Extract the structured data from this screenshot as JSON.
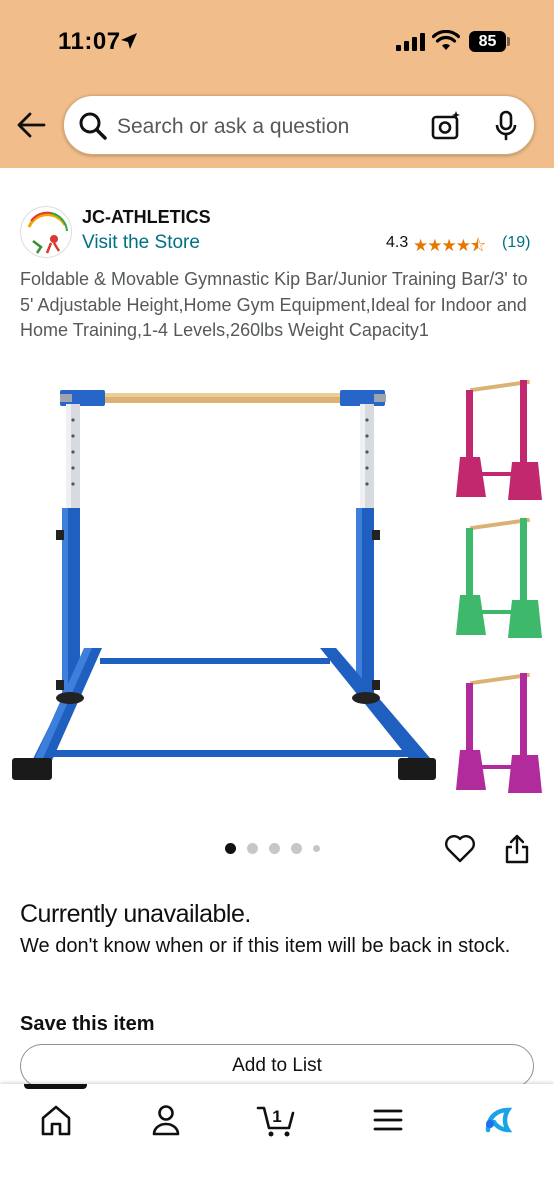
{
  "status_bar": {
    "time": "11:07",
    "battery": "85",
    "icons": [
      "location-arrow-icon",
      "signal-icon",
      "wifi-icon",
      "battery-icon"
    ]
  },
  "search": {
    "placeholder": "Search or ask a question",
    "icons": [
      "back-arrow-icon",
      "search-icon",
      "camera-icon",
      "mic-icon"
    ]
  },
  "store": {
    "brand": "JC-ATHLETICS",
    "visit": "Visit the Store",
    "logo_text": "JC-ATHLETICS"
  },
  "rating": {
    "value": "4.3",
    "stars": "★★★★⯪",
    "count": "(19)"
  },
  "product": {
    "title": "Foldable & Movable Gymnastic Kip Bar/Junior Training Bar/3' to 5' Adjustable Height,Home Gym Equipment,Ideal for Indoor and Home Training,1-4 Levels,260lbs Weight Capacity1",
    "image_count": 5,
    "active_image": 1,
    "thumbnail_colors": [
      "#c2286e",
      "#3eb86a",
      "#b22b9c"
    ]
  },
  "availability": {
    "heading": "Currently unavailable.",
    "message": "We don't know when or if this item will be back in stock."
  },
  "save": {
    "heading": "Save this item",
    "add_to_list": "Add to List"
  },
  "bottom_nav": {
    "items": [
      "home-icon",
      "account-icon",
      "cart-icon",
      "menu-icon",
      "rufus-icon"
    ],
    "cart_count": "1"
  },
  "colors": {
    "header_bg": "#f0bd8b",
    "link": "#007185",
    "star": "#e77600",
    "frame_blue": "#1f5fbf"
  }
}
